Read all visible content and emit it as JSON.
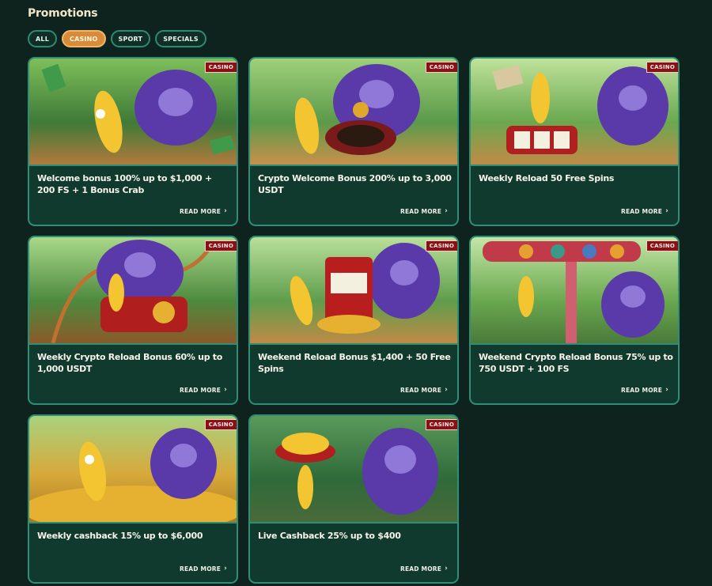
{
  "page": {
    "title": "Promotions"
  },
  "filters": [
    {
      "label": "ALL",
      "active": false
    },
    {
      "label": "CASINO",
      "active": true
    },
    {
      "label": "SPORT",
      "active": false
    },
    {
      "label": "SPECIALS",
      "active": false
    }
  ],
  "promotions": [
    {
      "tag": "CASINO",
      "title": "Welcome bonus 100% up to $1,000 + 200 FS + 1 Bonus Crab",
      "cta": "READ MORE"
    },
    {
      "tag": "CASINO",
      "title": "Crypto Welcome Bonus 200% up to 3,000 USDT",
      "cta": "READ MORE"
    },
    {
      "tag": "CASINO",
      "title": "Weekly Reload 50 Free Spins",
      "cta": "READ MORE"
    },
    {
      "tag": "CASINO",
      "title": "Weekly Crypto Reload Bonus 60% up to 1,000 USDT",
      "cta": "READ MORE"
    },
    {
      "tag": "CASINO",
      "title": "Weekend Reload Bonus $1,400 + 50 Free Spins",
      "cta": "READ MORE"
    },
    {
      "tag": "CASINO",
      "title": "Weekend Crypto Reload Bonus 75% up to 750 USDT + 100 FS",
      "cta": "READ MORE"
    },
    {
      "tag": "CASINO",
      "title": "Weekly cashback 15% up to $6,000",
      "cta": "READ MORE"
    },
    {
      "tag": "CASINO",
      "title": "Live Cashback 25% up to $400",
      "cta": "READ MORE"
    }
  ],
  "icons": {
    "chevron": "chevron-right-icon"
  },
  "colors": {
    "accent": "#d88c3a",
    "card_border": "#2f8f76",
    "tag": "#8b1014",
    "background": "#0e231d"
  }
}
